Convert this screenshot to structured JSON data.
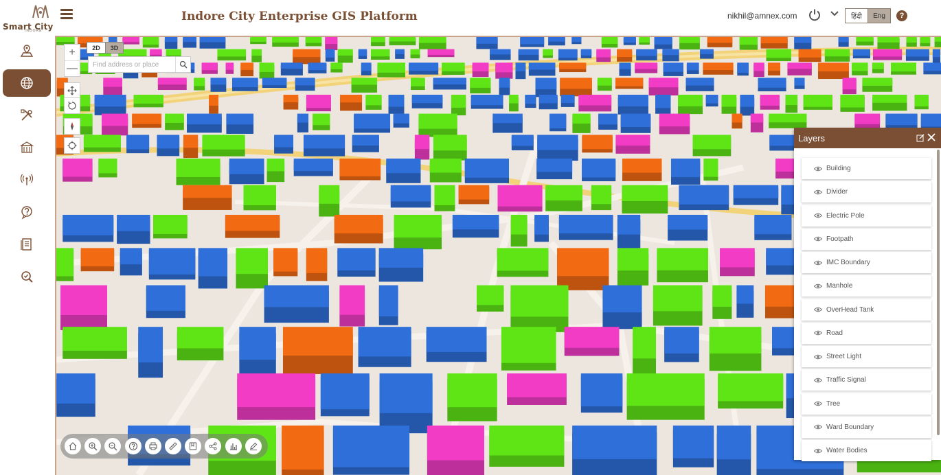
{
  "header": {
    "logo_text": "Smart City",
    "logo_subtext": "INDORE",
    "title": "Indore City Enterprise GIS Platform",
    "user_email": "nikhil@amnex.com",
    "lang_hindi": "हिंदी",
    "lang_english": "Eng",
    "help_label": "?",
    "icons": [
      "menu-icon",
      "power-icon",
      "chevron-down-icon",
      "help-icon"
    ]
  },
  "sidebar": {
    "items": [
      {
        "name": "sidebar-item-map-location",
        "icon": "map-pin-icon",
        "active": false
      },
      {
        "name": "sidebar-item-globe",
        "icon": "globe-icon",
        "active": true
      },
      {
        "name": "sidebar-item-tools",
        "icon": "tools-icon",
        "active": false
      },
      {
        "name": "sidebar-item-building",
        "icon": "building-icon",
        "active": false
      },
      {
        "name": "sidebar-item-antenna",
        "icon": "antenna-icon",
        "active": false
      },
      {
        "name": "sidebar-item-help",
        "icon": "question-icon",
        "active": false
      },
      {
        "name": "sidebar-item-report",
        "icon": "report-icon",
        "active": false
      },
      {
        "name": "sidebar-item-search",
        "icon": "search-check-icon",
        "active": false
      }
    ]
  },
  "map": {
    "view_2d": "2D",
    "view_3d": "3D",
    "view_selected": "2D",
    "zoom_in": "+",
    "zoom_out": "—",
    "search_placeholder": "Find address or place",
    "colors": {
      "blue": "#2e6fd9",
      "green": "#5fe516",
      "orange": "#f26a12",
      "magenta": "#f23cc6",
      "road": "#f4eee8",
      "highway": "#f3d37a"
    }
  },
  "toolbar": {
    "tools": [
      "home-icon",
      "zoom-in-icon",
      "zoom-out-icon",
      "help-icon",
      "print-icon",
      "measure-icon",
      "bookmark-icon",
      "share-icon",
      "chart-icon",
      "edit-icon"
    ]
  },
  "layers": {
    "title": "Layers",
    "items": [
      "Building",
      "Divider",
      "Electric Pole",
      "Footpath",
      "IMC Boundary",
      "Manhole",
      "OverHead Tank",
      "Road",
      "Street Light",
      "Traffic Signal",
      "Tree",
      "Ward Boundary",
      "Water Bodies"
    ]
  }
}
